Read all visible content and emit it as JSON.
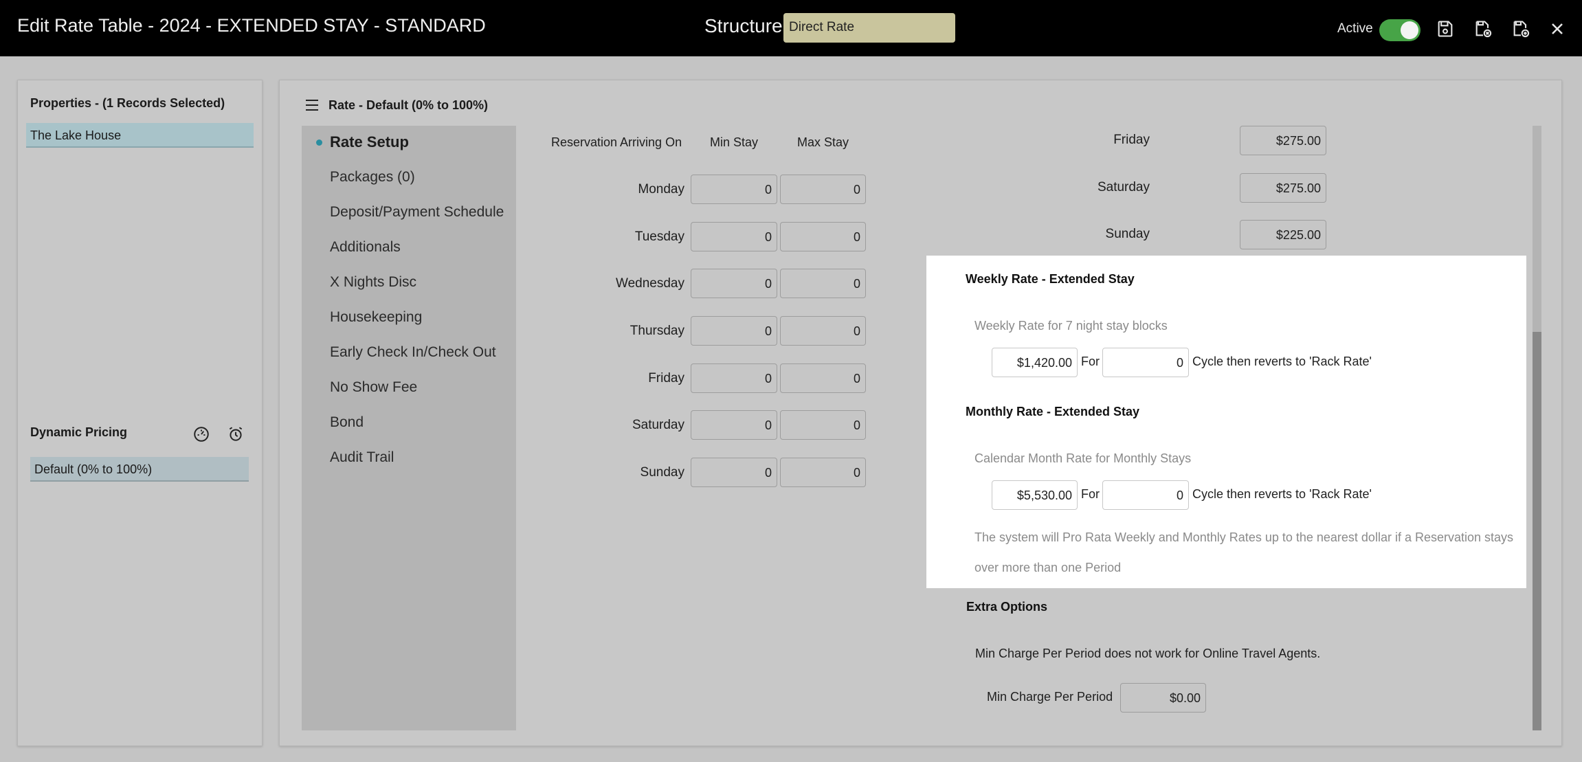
{
  "header": {
    "title": "Edit Rate Table - 2024 - EXTENDED STAY - STANDARD",
    "structure_label": "Structure",
    "structure_value": "Direct Rate",
    "active_label": "Active",
    "active_on": true
  },
  "properties": {
    "heading": "Properties - (1 Records Selected)",
    "items": [
      "The Lake House"
    ]
  },
  "dynamic_pricing": {
    "heading": "Dynamic Pricing",
    "items": [
      "Default (0% to 100%)"
    ]
  },
  "main": {
    "title": "Rate - Default (0% to 100%)",
    "nav": [
      {
        "label": "Rate Setup",
        "active": true
      },
      {
        "label": "Packages (0)"
      },
      {
        "label": "Deposit/Payment Schedule"
      },
      {
        "label": "Additionals"
      },
      {
        "label": "X Nights Disc"
      },
      {
        "label": "Housekeeping"
      },
      {
        "label": "Early Check In/Check Out"
      },
      {
        "label": "No Show Fee"
      },
      {
        "label": "Bond"
      },
      {
        "label": "Audit Trail"
      }
    ],
    "stay_table": {
      "headers": [
        "Reservation Arriving On",
        "Min Stay",
        "Max Stay"
      ],
      "rows": [
        {
          "day": "Monday",
          "min": "0",
          "max": "0"
        },
        {
          "day": "Tuesday",
          "min": "0",
          "max": "0"
        },
        {
          "day": "Wednesday",
          "min": "0",
          "max": "0"
        },
        {
          "day": "Thursday",
          "min": "0",
          "max": "0"
        },
        {
          "day": "Friday",
          "min": "0",
          "max": "0"
        },
        {
          "day": "Saturday",
          "min": "0",
          "max": "0"
        },
        {
          "day": "Sunday",
          "min": "0",
          "max": "0"
        }
      ]
    },
    "day_rates": [
      {
        "day": "Friday",
        "rate": "$275.00"
      },
      {
        "day": "Saturday",
        "rate": "$275.00"
      },
      {
        "day": "Sunday",
        "rate": "$225.00"
      }
    ],
    "extended_stay": {
      "weekly_heading": "Weekly Rate - Extended Stay",
      "weekly_sub": "Weekly Rate for 7 night stay blocks",
      "weekly_rate": "$1,420.00",
      "weekly_for": "For",
      "weekly_cycles": "0",
      "weekly_suffix": "Cycle then reverts to 'Rack Rate'",
      "monthly_heading": "Monthly Rate - Extended Stay",
      "monthly_sub": "Calendar Month Rate for Monthly Stays",
      "monthly_rate": "$5,530.00",
      "monthly_for": "For",
      "monthly_cycles": "0",
      "monthly_suffix": "Cycle then reverts to 'Rack Rate'",
      "note": "The system will Pro Rata Weekly and Monthly Rates up to the nearest dollar if a Reservation stays over more than one Period"
    },
    "extra_options": {
      "heading": "Extra Options",
      "warning": "Min Charge Per Period does not work for Online Travel Agents.",
      "min_charge_label": "Min Charge Per Period",
      "min_charge_value": "$0.00"
    }
  }
}
